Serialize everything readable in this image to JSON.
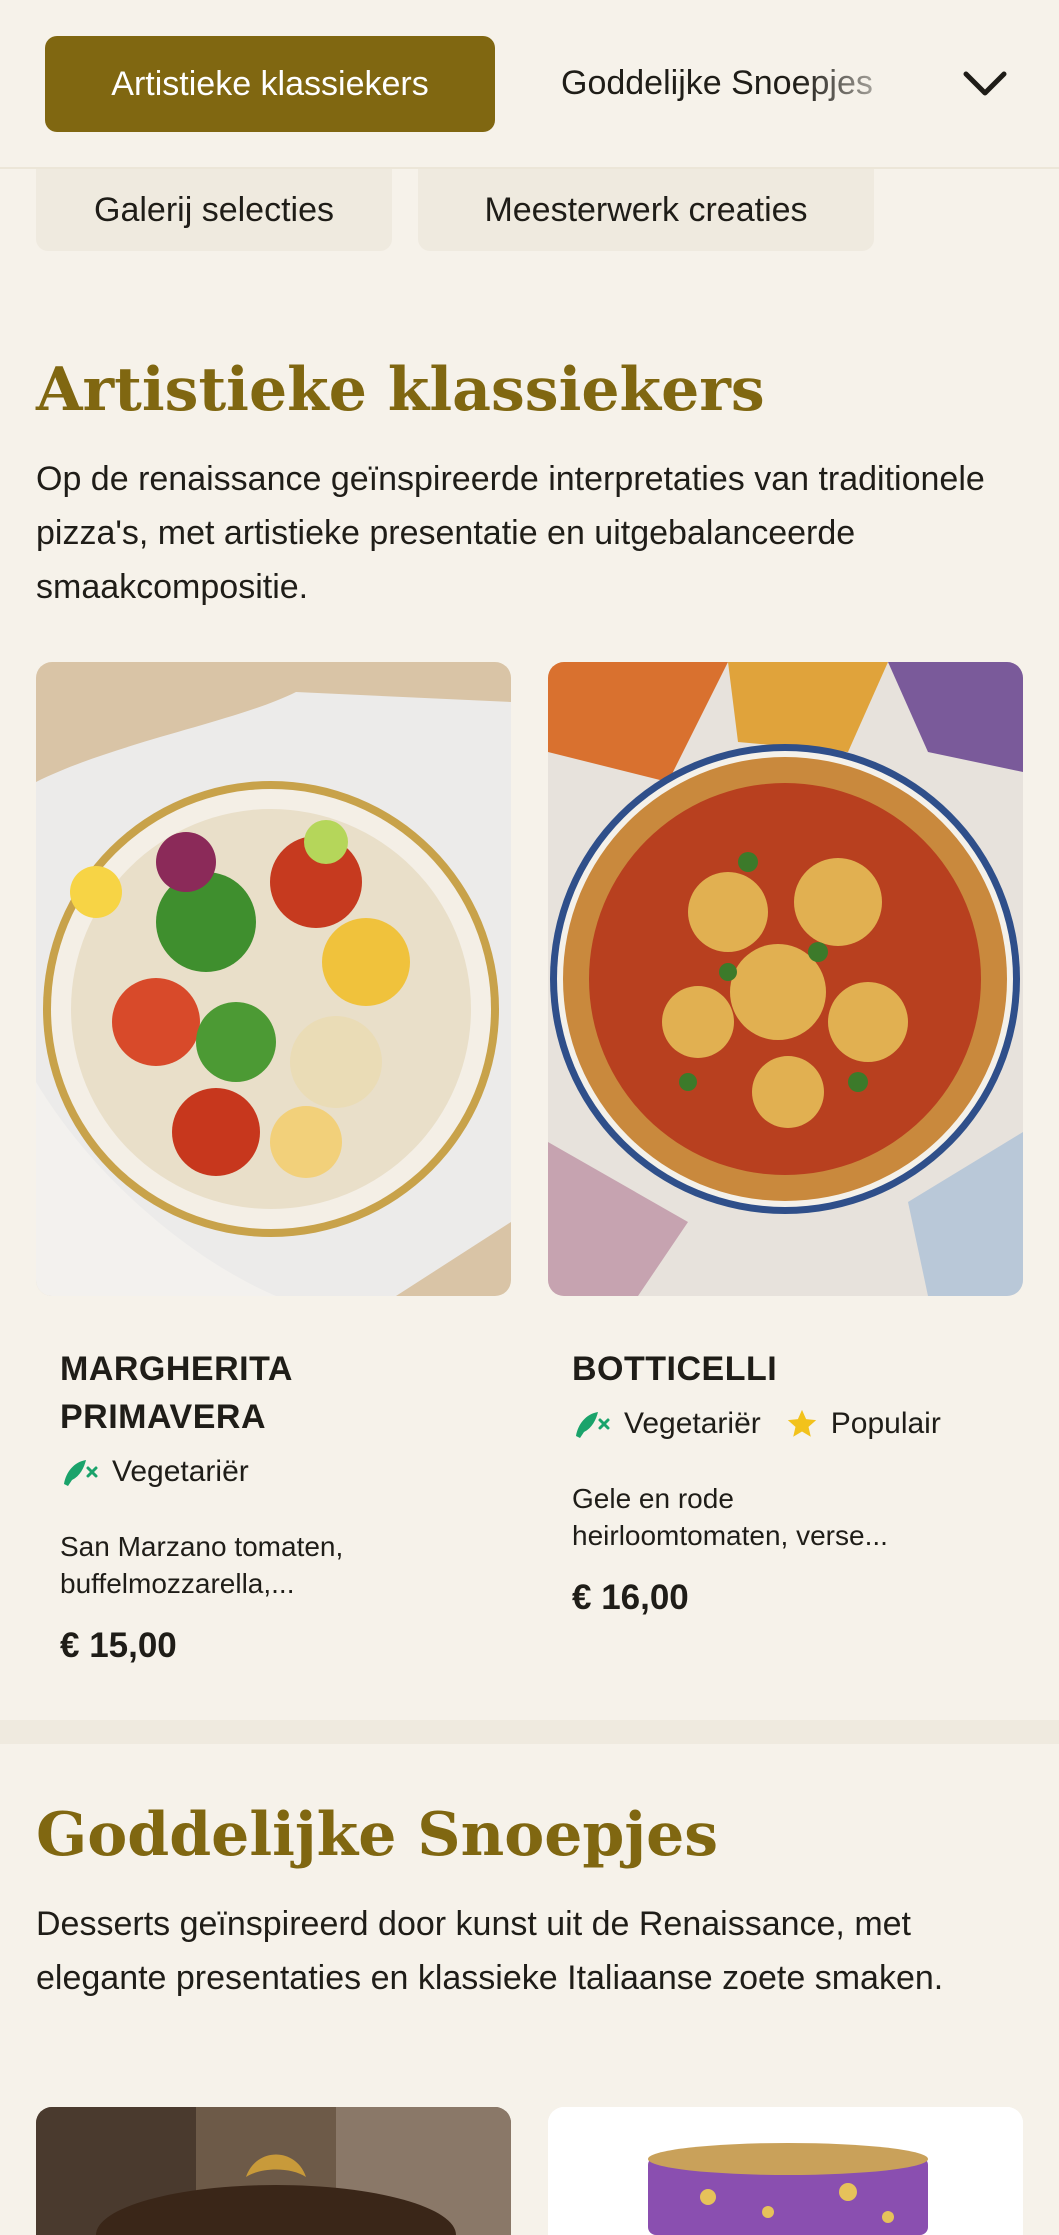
{
  "tabs": {
    "active": "Artistieke klassiekers",
    "next": "Goddelijke Snoepjes",
    "pills": [
      "Galerij selecties",
      "Meesterwerk creaties"
    ]
  },
  "sections": [
    {
      "title": "Artistieke klassiekers",
      "description": "Op de renaissance geïnspireerde interpretaties van traditionele pizza's, met artistieke presentatie en uitgebalanceerde smaakcompositie.",
      "items": [
        {
          "name_line1": "MARGHERITA",
          "name_line2": "PRIMAVERA",
          "badges": [
            "Vegetariër"
          ],
          "description_line1": "San Marzano tomaten,",
          "description_line2": "buffelmozzarella,...",
          "price": "€ 15,00"
        },
        {
          "name_line1": "BOTTICELLI",
          "badges": [
            "Vegetariër",
            "Populair"
          ],
          "description_line1": "Gele en rode",
          "description_line2": "heirloomtomaten, verse...",
          "price": "€ 16,00"
        }
      ]
    },
    {
      "title": "Goddelijke Snoepjes",
      "description": "Desserts geïnspireerd door kunst uit de Renaissance, met elegante presentaties en klassieke Italiaanse zoete smaken."
    }
  ],
  "colors": {
    "accent": "#806711",
    "background": "#f6f2ea",
    "vegetarian_icon": "#1aa36b",
    "popular_icon": "#f2c21b"
  },
  "icons": [
    "chevron-down-icon",
    "vegetarian-icon",
    "star-icon"
  ]
}
